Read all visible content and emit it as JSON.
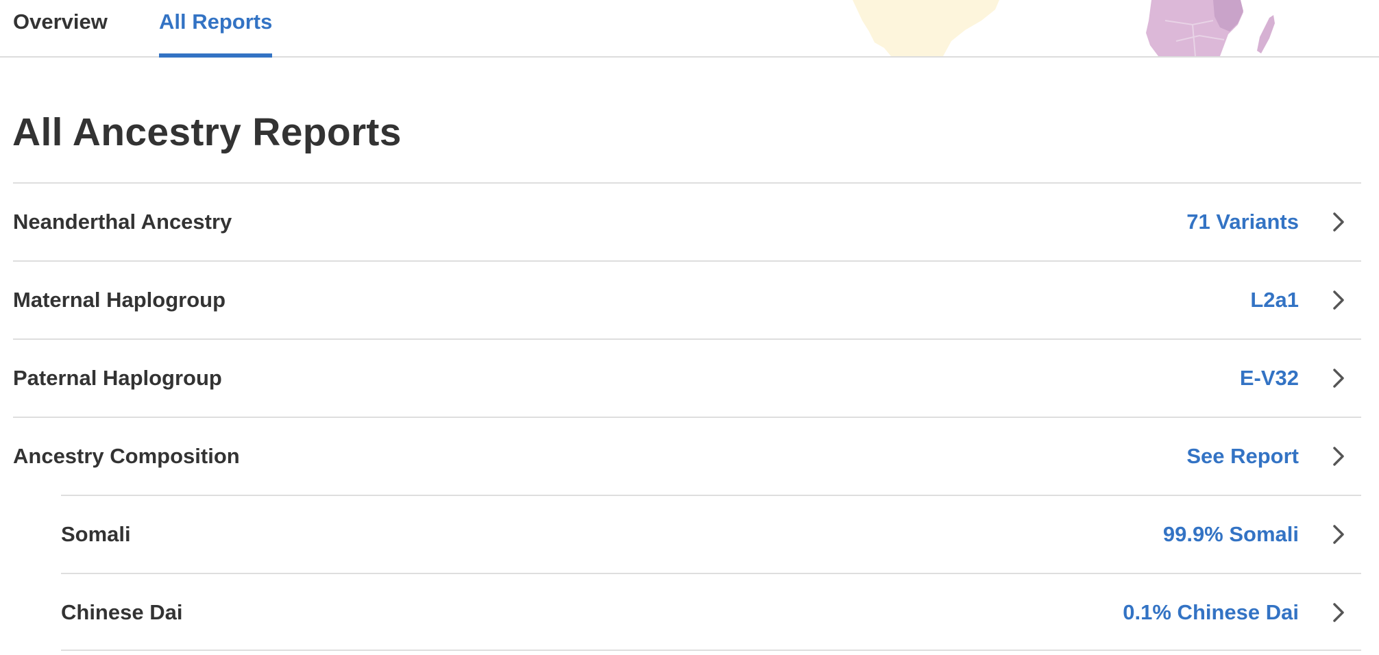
{
  "tabs": [
    {
      "label": "Overview",
      "active": false
    },
    {
      "label": "All Reports",
      "active": true
    }
  ],
  "page_title": "All Ancestry Reports",
  "reports": [
    {
      "label": "Neanderthal Ancestry",
      "value": "71 Variants",
      "indent": false
    },
    {
      "label": "Maternal Haplogroup",
      "value": "L2a1",
      "indent": false
    },
    {
      "label": "Paternal Haplogroup",
      "value": "E-V32",
      "indent": false
    },
    {
      "label": "Ancestry Composition",
      "value": "See Report",
      "indent": false
    },
    {
      "label": "Somali",
      "value": "99.9% Somali",
      "indent": true
    },
    {
      "label": "Chinese Dai",
      "value": "0.1% Chinese Dai",
      "indent": true
    }
  ],
  "colors": {
    "accent": "#3373c4",
    "text": "#333333",
    "divider": "#dedede",
    "map_yellow": "#fdf5dc",
    "map_purple": "#d9b5d6"
  },
  "icons": {
    "row_chevron": "chevron-right-icon",
    "header_map": "africa-map-illustration"
  }
}
